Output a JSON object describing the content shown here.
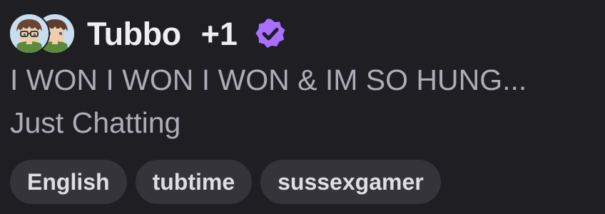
{
  "channel": {
    "name": "Tubbo",
    "extra_count": "+1",
    "verified": true,
    "avatar_icons": [
      "avatar-tubbo",
      "avatar-guest"
    ]
  },
  "stream": {
    "title": "I WON I WON I WON & IM SO HUNG...",
    "category": "Just Chatting"
  },
  "tags": [
    "English",
    "tubtime",
    "sussexgamer"
  ],
  "colors": {
    "background": "#1f1e23",
    "verified_badge": "#a970ff",
    "tag_bg": "#35343a"
  }
}
